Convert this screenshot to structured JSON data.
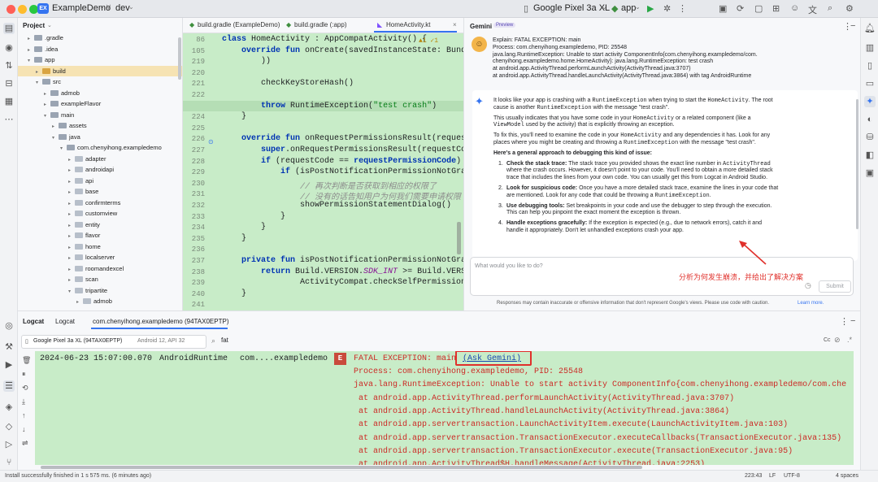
{
  "titlebar": {
    "project_badge": "EX",
    "project_name": "ExampleDemo",
    "branch": "dev",
    "device": "Google Pixel 3a XL",
    "run_config": "app"
  },
  "project_panel": {
    "title": "Project",
    "rows": [
      {
        "label": ".gradle",
        "depth": 1
      },
      {
        "label": ".idea",
        "depth": 1
      },
      {
        "label": "app",
        "depth": 1
      },
      {
        "label": "build",
        "depth": 2
      },
      {
        "label": "src",
        "depth": 2
      },
      {
        "label": "admob",
        "depth": 3
      },
      {
        "label": "exampleFlavor",
        "depth": 3
      },
      {
        "label": "main",
        "depth": 3
      },
      {
        "label": "assets",
        "depth": 4
      },
      {
        "label": "java",
        "depth": 4
      },
      {
        "label": "com.chenyihong.exampledemo",
        "depth": 5
      },
      {
        "label": "adapter",
        "depth": 6
      },
      {
        "label": "androidapi",
        "depth": 6
      },
      {
        "label": "api",
        "depth": 6
      },
      {
        "label": "base",
        "depth": 6
      },
      {
        "label": "confirmterms",
        "depth": 6
      },
      {
        "label": "customview",
        "depth": 6
      },
      {
        "label": "entity",
        "depth": 6
      },
      {
        "label": "flavor",
        "depth": 6
      },
      {
        "label": "home",
        "depth": 6
      },
      {
        "label": "localserver",
        "depth": 6
      },
      {
        "label": "roomandexcel",
        "depth": 6
      },
      {
        "label": "scan",
        "depth": 6
      },
      {
        "label": "tripartite",
        "depth": 6
      },
      {
        "label": "admob",
        "depth": 7
      }
    ]
  },
  "editor": {
    "tabs": [
      "build.gradle (ExampleDemo)",
      "build.gradle (:app)",
      "HomeActivity.kt"
    ],
    "inspection_summary": "▲1 ✓1",
    "lines": [
      {
        "n": "86",
        "html": "<span class='kw'>class</span> HomeActivity : AppCompatActivity() {"
      },
      {
        "n": "105",
        "html": "    <span class='kw'>override fun</span> onCreate(savedInstanceState: Bundle"
      },
      {
        "n": "219",
        "html": "        ))"
      },
      {
        "n": "220",
        "html": ""
      },
      {
        "n": "221",
        "html": "        checkKeyStoreHash()"
      },
      {
        "n": "222",
        "html": ""
      },
      {
        "n": "223",
        "html": "        <span class='kw'>throw</span> RuntimeException(<span class='str'>\"test crash\"</span>)"
      },
      {
        "n": "224",
        "html": "    }"
      },
      {
        "n": "225",
        "html": ""
      },
      {
        "n": "226",
        "html": "    <span class='kw'>override fun</span> onRequestPermissionsResult(requestC"
      },
      {
        "n": "227",
        "html": "        <span class='kw'>super</span>.onRequestPermissionsResult(requestCode"
      },
      {
        "n": "228",
        "html": "        <span class='kw'>if</span> (requestCode == <span class='kw'>requestPermissionCode</span>) {"
      },
      {
        "n": "229",
        "html": "            <span class='kw'>if</span> (isPostNotificationPermissionNotGrant"
      },
      {
        "n": "230",
        "html": "                <span class='cm'>// 再次判断是否获取到相应的权限了</span>"
      },
      {
        "n": "231",
        "html": "                <span class='cm'>// 没有的话告知用户为何我们需要申请权限</span>"
      },
      {
        "n": "232",
        "html": "                showPermissionStatementDialog()"
      },
      {
        "n": "233",
        "html": "            }"
      },
      {
        "n": "234",
        "html": "        }"
      },
      {
        "n": "235",
        "html": "    }"
      },
      {
        "n": "236",
        "html": ""
      },
      {
        "n": "237",
        "html": "    <span class='kw'>private fun</span> isPostNotificationPermissionNotGrant"
      },
      {
        "n": "238",
        "html": "        <span class='kw'>return</span> Build.VERSION.<span class='it'>SDK_INT</span> >= Build.VERSIO"
      },
      {
        "n": "239",
        "html": "                ActivityCompat.checkSelfPermission("
      },
      {
        "n": "240",
        "html": "    }"
      },
      {
        "n": "241",
        "html": ""
      }
    ]
  },
  "gemini": {
    "title": "Gemini",
    "badge": "Preview",
    "query_lines": [
      "Explain: FATAL EXCEPTION: main",
      "Process: com.chenyihong.exampledemo, PID: 25548",
      "java.lang.RuntimeException: Unable to start activity ComponentInfo{com.chenyihong.exampledemo/com.",
      "chenyihong.exampledemo.home.HomeActivity}: java.lang.RuntimeException: test crash",
      "at android.app.ActivityThread.performLaunchActivity(ActivityThread.java:3707)",
      "at android.app.ActivityThread.handleLaunchActivity(ActivityThread.java:3864) with tag AndroidRuntime"
    ],
    "answer_html": [
      "It looks like your app is crashing with a <span class='gm'>RuntimeException</span> when trying to start the <span class='gm'>HomeActivity</span>. The root",
      "cause is another <span class='gm'>RuntimeException</span> with the message \"test crash\".",
      "",
      "This usually indicates that you have some code in your <span class='gm'>HomeActivity</span> or a related component (like a",
      "<span class='gm'>ViewModel</span> used by the activity) that is explicitly throwing an exception.",
      "",
      "To fix this, you'll need to examine the code in your <span class='gm'>HomeActivity</span> and any dependencies it has. Look for any",
      "places where you might be creating and throwing a <span class='gm'>RuntimeException</span> with the message \"test crash\".",
      "",
      "<b>Here's a general approach to debugging this kind of issue:</b>"
    ],
    "steps": [
      {
        "num": "1.",
        "lines": [
          "<b>Check the stack trace:</b> The stack trace you provided shows the exact line number in <span class='gm'>ActivityThread</span>",
          "where the crash occurs. However, it doesn't point to your code. You'll need to obtain a more detailed stack",
          "trace that includes the lines from your own code. You can usually get this from Logcat in Android Studio."
        ]
      },
      {
        "num": "2.",
        "lines": [
          "<b>Look for suspicious code:</b> Once you have a more detailed stack trace, examine the lines in your code that",
          "are mentioned. Look for any code that could be throwing a <span class='gm'>RuntimeException</span>."
        ]
      },
      {
        "num": "3.",
        "lines": [
          "<b>Use debugging tools:</b> Set breakpoints in your code and use the debugger to step through the execution.",
          "This can help you pinpoint the exact moment the exception is thrown."
        ]
      },
      {
        "num": "4.",
        "lines": [
          "<b>Handle exceptions gracefully:</b> If the exception is expected (e.g., due to network errors), catch it and",
          "handle it appropriately. Don't let unhandled exceptions crash your app."
        ]
      }
    ],
    "prompt_placeholder": "What would you like to do?",
    "submit_label": "Submit",
    "disclaimer": "Responses may contain inaccurate or offensive information that don't represent Google's views. Please use code with caution.",
    "learn_more": "Learn more.",
    "annotation": "分析为何发生崩溃，并给出了解决方案"
  },
  "logcat": {
    "tab_logcat": "Logcat",
    "tab_logcat2": "Logcat",
    "tab_session": "com.chenyihong.exampledemo (94TAX0EPTP)",
    "device_select": "Google Pixel 3a XL (94TAX0EPTP)",
    "device_api": "Android 12, API 32",
    "filter": "fat",
    "cc": "Cc",
    "timestamp": "2024-06-23 15:07:00.070",
    "tag": "AndroidRuntime",
    "package": "com....exampledemo",
    "level": "E",
    "first_line": "FATAL EXCEPTION: main",
    "ask_gemini": "(Ask Gemini)",
    "lines": [
      "Process: com.chenyihong.exampledemo, PID: 25548",
      "java.lang.RuntimeException: Unable to start activity ComponentInfo{com.chenyihong.exampledemo/com.che",
      " at android.app.ActivityThread.performLaunchActivity(ActivityThread.java:3707)",
      " at android.app.ActivityThread.handleLaunchActivity(ActivityThread.java:3864)",
      " at android.app.servertransaction.LaunchActivityItem.execute(LaunchActivityItem.java:103)",
      " at android.app.servertransaction.TransactionExecutor.executeCallbacks(TransactionExecutor.java:135)",
      " at android.app.servertransaction.TransactionExecutor.execute(TransactionExecutor.java:95)",
      " at android.app.ActivityThread$H.handleMessage(ActivityThread.java:2253)"
    ]
  },
  "statusbar": {
    "message": "Install successfully finished in 1 s 575 ms. (6 minutes ago)",
    "position": "223:43",
    "line_sep": "LF",
    "encoding": "UTF-8",
    "indent": "4 spaces"
  },
  "colors": {
    "accent": "#3574f0",
    "error_text": "#cc2a26",
    "log_bg": "#c8ecc8",
    "annotation_red": "#e0302b"
  }
}
